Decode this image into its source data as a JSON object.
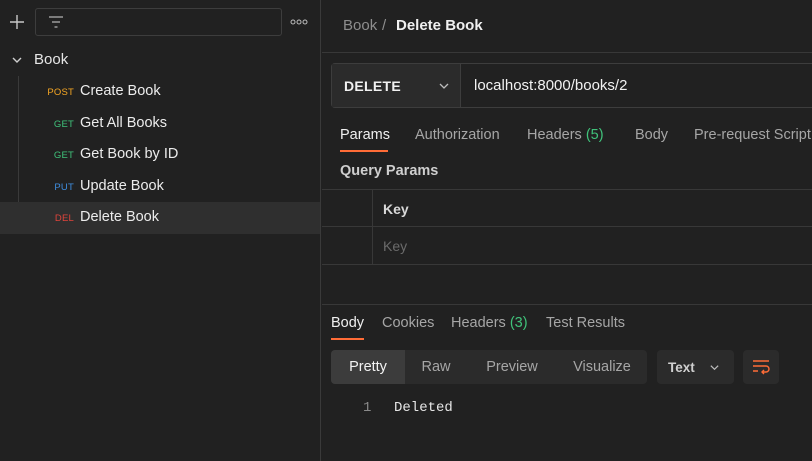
{
  "sidebar": {
    "filter_placeholder": "",
    "collection": {
      "name": "Book"
    },
    "requests": [
      {
        "method": "POST",
        "method_color": "#f5a623",
        "title": "Create Book",
        "active": false
      },
      {
        "method": "GET",
        "method_color": "#3fc27a",
        "title": "Get All Books",
        "active": false
      },
      {
        "method": "GET",
        "method_color": "#3fc27a",
        "title": "Get Book by ID",
        "active": false
      },
      {
        "method": "PUT",
        "method_color": "#3f8ee0",
        "title": "Update Book",
        "active": false
      },
      {
        "method": "DEL",
        "method_color": "#e0443b",
        "title": "Delete Book",
        "active": true
      }
    ]
  },
  "breadcrumb": {
    "collection": "Book",
    "separator": "/",
    "request": "Delete Book"
  },
  "request": {
    "method": "DELETE",
    "url": "localhost:8000/books/2",
    "tabs": [
      {
        "label": "Params",
        "count": "",
        "active": true
      },
      {
        "label": "Authorization",
        "count": "",
        "active": false
      },
      {
        "label": "Headers",
        "count": "(5)",
        "active": false
      },
      {
        "label": "Body",
        "count": "",
        "active": false
      },
      {
        "label": "Pre-request Script",
        "count": "",
        "active": false
      }
    ],
    "query_params": {
      "title": "Query Params",
      "column_key": "Key",
      "key_placeholder": "Key"
    }
  },
  "response": {
    "tabs": [
      {
        "label": "Body",
        "count": "",
        "active": true
      },
      {
        "label": "Cookies",
        "count": "",
        "active": false
      },
      {
        "label": "Headers",
        "count": "(3)",
        "active": false
      },
      {
        "label": "Test Results",
        "count": "",
        "active": false
      }
    ],
    "formats": [
      "Pretty",
      "Raw",
      "Preview",
      "Visualize"
    ],
    "active_format": "Pretty",
    "language": "Text",
    "lines": [
      {
        "number": "1",
        "text": "Deleted"
      }
    ]
  },
  "colors": {
    "accent": "#ff6c37",
    "count_green": "#40c27a"
  }
}
